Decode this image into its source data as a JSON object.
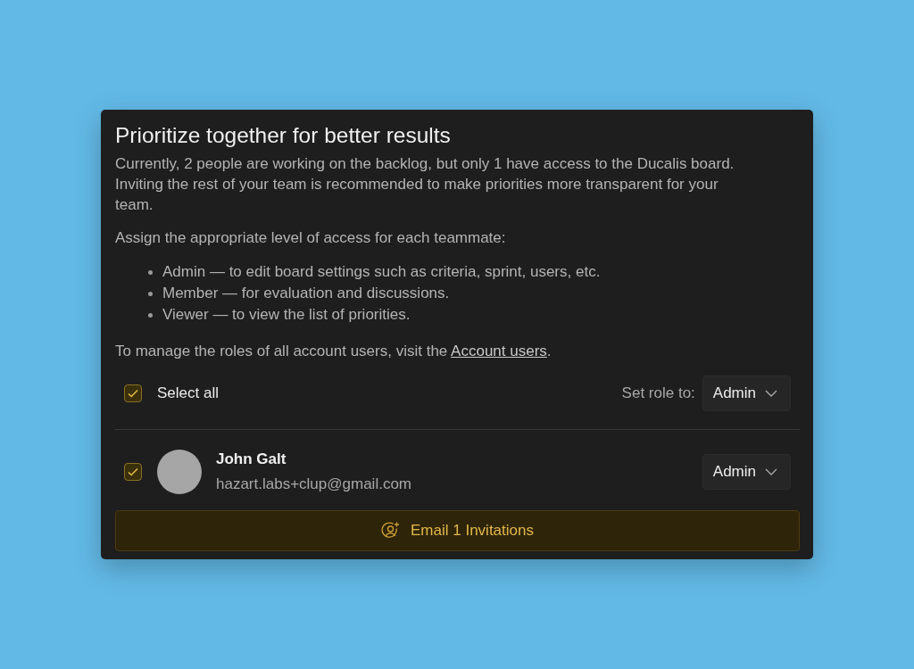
{
  "dialog": {
    "title": "Prioritize together for better results",
    "intro": "Currently, 2 people are working on the backlog, but only 1 have access to the Ducalis board. Inviting the rest of your team is recommended to make priorities more transparent for your team.",
    "roles_heading": "Assign the appropriate level of access for each teammate:",
    "roles": [
      "Admin — to edit board settings such as criteria, sprint, users, etc.",
      "Member — for evaluation and discussions.",
      "Viewer — to view the list of priorities."
    ],
    "manage_note": {
      "before": "To manage the roles of all account users, visit the ",
      "link": "Account users",
      "after": "."
    },
    "select_all": {
      "label": "Select all",
      "checked": true,
      "set_role_label": "Set role to:",
      "role": "Admin"
    },
    "users": [
      {
        "name": "John Galt",
        "email": "hazart.labs+clup@gmail.com",
        "checked": true,
        "role": "Admin"
      }
    ],
    "invite_button": "Email 1 Invitations"
  }
}
